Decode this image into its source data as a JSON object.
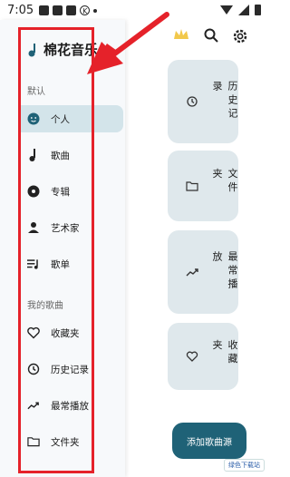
{
  "status_bar": {
    "time": "7:05"
  },
  "drawer": {
    "title": "棉花音乐",
    "section_default": "默认",
    "default_items": [
      {
        "label": "个人",
        "icon": "person-face-icon",
        "active": true
      },
      {
        "label": "歌曲",
        "icon": "music-note-icon"
      },
      {
        "label": "专辑",
        "icon": "album-disc-icon"
      },
      {
        "label": "艺术家",
        "icon": "artist-icon"
      },
      {
        "label": "歌单",
        "icon": "playlist-icon"
      }
    ],
    "section_my": "我的歌曲",
    "my_items": [
      {
        "label": "收藏夹",
        "icon": "heart-icon"
      },
      {
        "label": "历史记录",
        "icon": "history-icon"
      },
      {
        "label": "最常播放",
        "icon": "trending-up-icon"
      },
      {
        "label": "文件夹",
        "icon": "folder-icon"
      }
    ]
  },
  "cards": [
    {
      "label": "历史记录",
      "icon": "history-icon"
    },
    {
      "label": "文件夹",
      "icon": "folder-icon"
    },
    {
      "label": "最常播放",
      "icon": "trending-up-icon"
    },
    {
      "label": "收藏夹",
      "icon": "heart-icon"
    }
  ],
  "fab_label": "添加歌曲源",
  "watermark": "绿色下载站",
  "colors": {
    "accent": "#1f6277",
    "highlight": "#e5222a",
    "active_bg": "#d3e4ea"
  }
}
